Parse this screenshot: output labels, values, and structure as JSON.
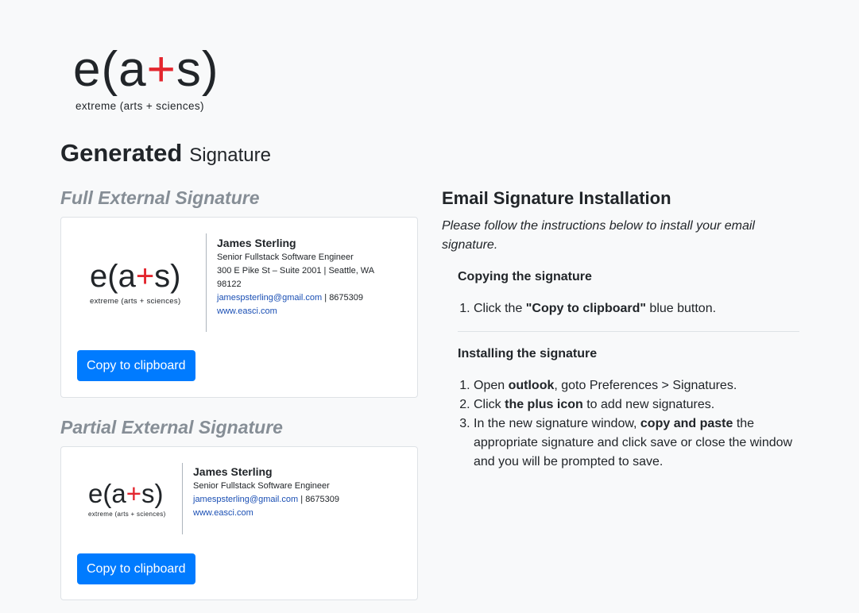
{
  "brand": {
    "logo_prefix": "e(a",
    "logo_plus": "+",
    "logo_suffix": "s)",
    "tagline": "extreme (arts + sciences)",
    "accent_color": "#e3262e"
  },
  "page": {
    "title_strong": "Generated",
    "title_light": "Signature"
  },
  "full_signature": {
    "section_title": "Full External Signature",
    "name": "James Sterling",
    "role": "Senior Fullstack Software Engineer",
    "address": "300 E Pike St – Suite 2001 | Seattle, WA 98122",
    "email": "jamespsterling@gmail.com",
    "phone_sep": " | 8675309",
    "website": "www.easci.com",
    "copy_label": "Copy to clipboard"
  },
  "partial_signature": {
    "section_title": "Partial External Signature",
    "name": "James Sterling",
    "role": "Senior Fullstack Software Engineer",
    "email": "jamespsterling@gmail.com",
    "phone_sep": " | 8675309",
    "website": "www.easci.com",
    "copy_label": "Copy to clipboard"
  },
  "installation": {
    "title": "Email Signature Installation",
    "intro": "Please follow the instructions below to install your email signature.",
    "copying": {
      "heading": "Copying the signature",
      "steps": [
        {
          "pre": "Click the ",
          "bold": "\"Copy to clipboard\"",
          "post": " blue button."
        }
      ]
    },
    "installing": {
      "heading": "Installing the signature",
      "steps": [
        {
          "pre": "Open ",
          "bold": "outlook",
          "post": ", goto Preferences > Signatures."
        },
        {
          "pre": "Click ",
          "bold": "the plus icon",
          "post": " to add new signatures."
        },
        {
          "pre": "In the new signature window, ",
          "bold": "copy and paste",
          "post": " the appropriate signature and click save or close the window and you will be prompted to save."
        }
      ]
    }
  },
  "colors": {
    "primary_button": "#007bff",
    "muted_heading": "#868e96",
    "link": "#1a4fb4"
  }
}
